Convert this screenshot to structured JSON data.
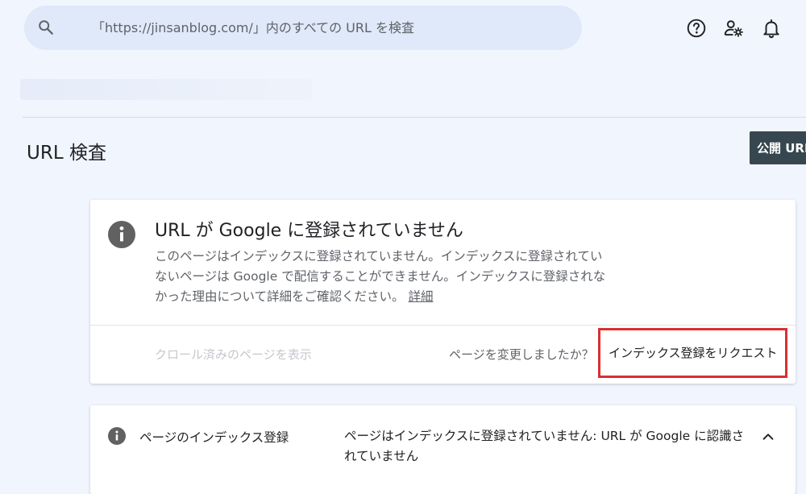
{
  "search": {
    "placeholder": "「https://jinsanblog.com/」内のすべての URL を検査",
    "value": ""
  },
  "icons": {
    "search": "search-icon",
    "help": "help-circle-icon",
    "account_settings": "account-settings-icon",
    "notifications": "bell-icon",
    "info": "info-icon",
    "collapse": "chevron-up-icon"
  },
  "header": {
    "title": "URL 検査",
    "public_url_button": "公開 URL"
  },
  "status_card": {
    "title": "URL が Google に登録されていません",
    "description": "このページはインデックスに登録されていません。インデックスに登録されていないページは Google で配信することができません。インデックスに登録されなかった理由について詳細をご確認ください。",
    "learn_more": "詳細",
    "view_crawled_page": "クロール済みのページを表示",
    "page_changed_question": "ページを変更しましたか？",
    "request_indexing": "インデックス登録をリクエスト"
  },
  "coverage": {
    "title": "ページのインデックス登録",
    "status": "ページはインデックスに登録されていません: URL が Google に認識されていません"
  },
  "colors": {
    "background": "#f1f5fd",
    "search_bar": "#dfe9f9",
    "public_url_button": "#37474f",
    "highlight": "#d93030",
    "icon_gray": "#616161"
  }
}
